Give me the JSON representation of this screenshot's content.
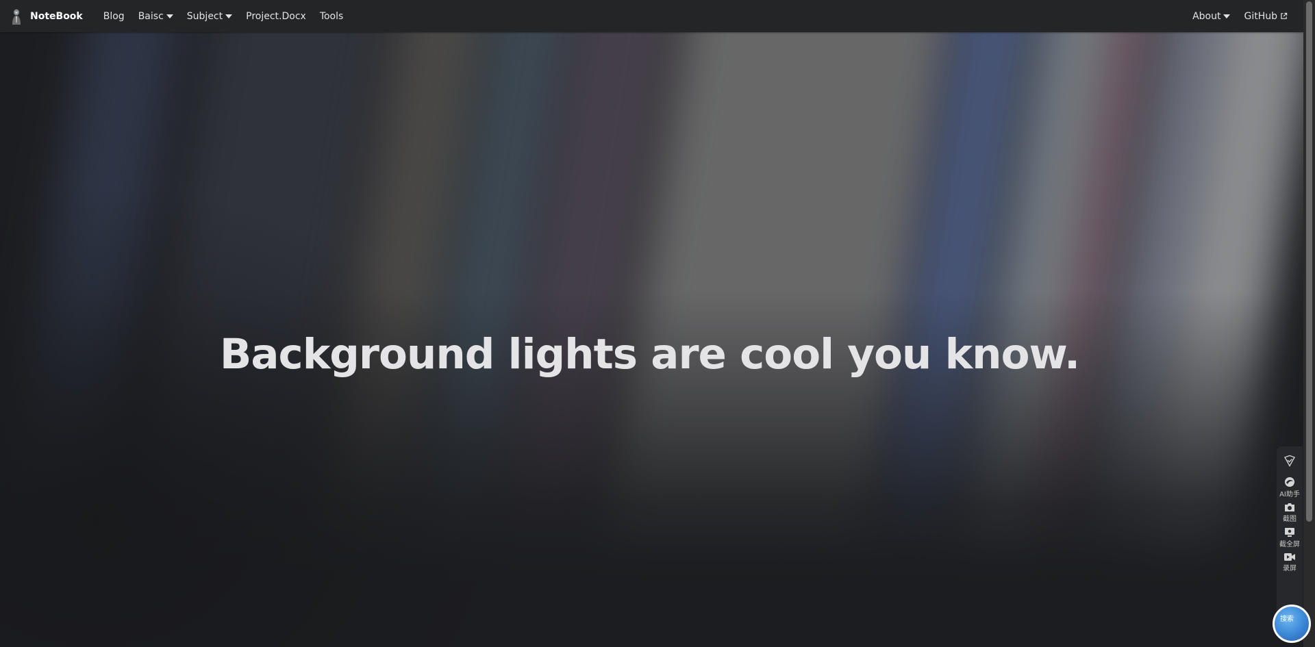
{
  "navbar": {
    "brand": "NoteBook",
    "items": [
      {
        "label": "Blog",
        "dropdown": false
      },
      {
        "label": "Baisc",
        "dropdown": true
      },
      {
        "label": "Subject",
        "dropdown": true
      },
      {
        "label": "Project.Docx",
        "dropdown": false
      },
      {
        "label": "Tools",
        "dropdown": false
      }
    ],
    "right_items": {
      "about": "About",
      "github": "GitHub"
    }
  },
  "hero": {
    "headline": "Background lights are cool you know."
  },
  "side_toolbar": {
    "tools": [
      {
        "icon": "shield-check-icon",
        "label": ""
      },
      {
        "icon": "ai-assistant-icon",
        "label": "AI助手"
      },
      {
        "icon": "camera-icon",
        "label": "截图"
      },
      {
        "icon": "monitor-icon",
        "label": "截全屏"
      },
      {
        "icon": "video-camera-icon",
        "label": "录屏"
      }
    ],
    "bubble_text": "搜索"
  },
  "colors": {
    "navbar_bg": "#242526",
    "page_bg": "#1c1d20",
    "headline": "#e4e4e6"
  }
}
